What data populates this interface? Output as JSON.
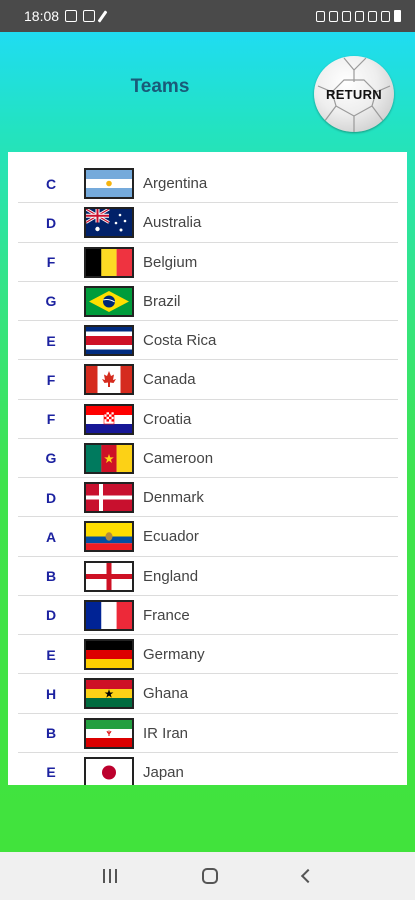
{
  "status_bar": {
    "time": "18:08"
  },
  "header": {
    "title": "Teams",
    "return_label": "RETURN"
  },
  "teams": [
    {
      "group": "C",
      "name": "Argentina",
      "flag": "argentina-flag-icon"
    },
    {
      "group": "D",
      "name": "Australia",
      "flag": "australia-flag-icon"
    },
    {
      "group": "F",
      "name": "Belgium",
      "flag": "belgium-flag-icon"
    },
    {
      "group": "G",
      "name": "Brazil",
      "flag": "brazil-flag-icon"
    },
    {
      "group": "E",
      "name": "Costa Rica",
      "flag": "costa-rica-flag-icon"
    },
    {
      "group": "F",
      "name": "Canada",
      "flag": "canada-flag-icon"
    },
    {
      "group": "F",
      "name": "Croatia",
      "flag": "croatia-flag-icon"
    },
    {
      "group": "G",
      "name": "Cameroon",
      "flag": "cameroon-flag-icon"
    },
    {
      "group": "D",
      "name": "Denmark",
      "flag": "denmark-flag-icon"
    },
    {
      "group": "A",
      "name": "Ecuador",
      "flag": "ecuador-flag-icon"
    },
    {
      "group": "B",
      "name": "England",
      "flag": "england-flag-icon"
    },
    {
      "group": "D",
      "name": "France",
      "flag": "france-flag-icon"
    },
    {
      "group": "E",
      "name": "Germany",
      "flag": "germany-flag-icon"
    },
    {
      "group": "H",
      "name": "Ghana",
      "flag": "ghana-flag-icon"
    },
    {
      "group": "B",
      "name": "IR Iran",
      "flag": "iran-flag-icon"
    },
    {
      "group": "E",
      "name": "Japan",
      "flag": "japan-flag-icon"
    }
  ],
  "colors": {
    "group_letter": "#1c22a0",
    "team_name": "#444444",
    "title": "#1a5a78",
    "gradient_top": "#1fdcf2",
    "gradient_bottom": "#41e33c"
  }
}
